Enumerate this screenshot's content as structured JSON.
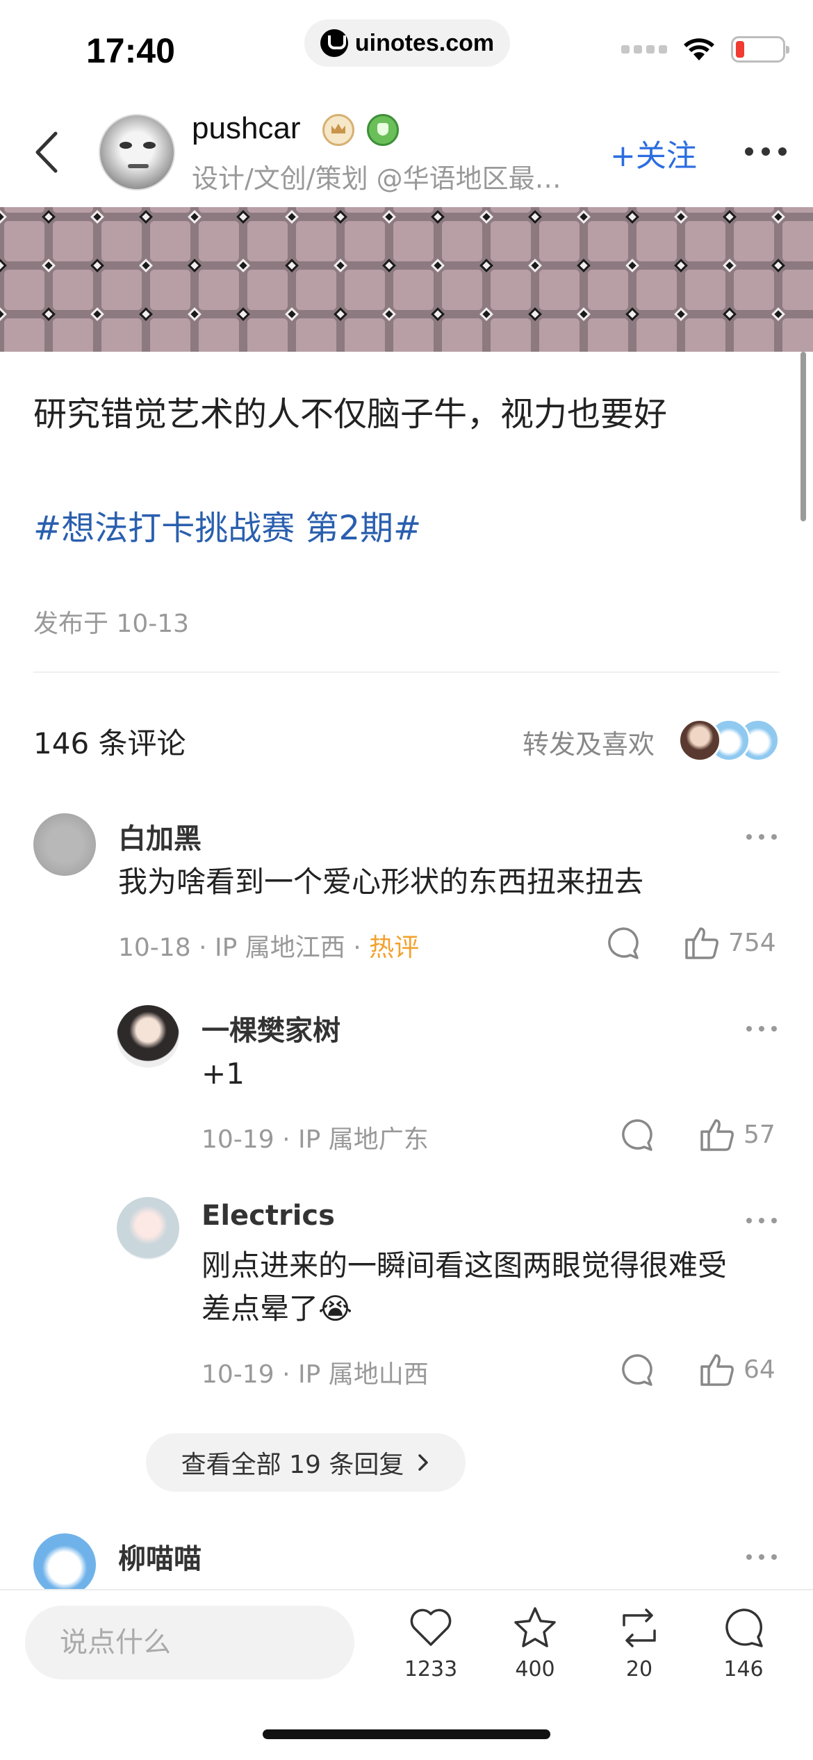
{
  "status_bar": {
    "time": "17:40",
    "url": "uinotes.com"
  },
  "header": {
    "user_name": "pushcar",
    "user_desc": "设计/文创/策划 @华语地区最…",
    "follow_label": "+关注",
    "back_icon": "chevron-left-icon",
    "more_icon": "more-horizontal-icon"
  },
  "post": {
    "text": "研究错觉艺术的人不仅脑子牛，视力也要好",
    "tag": "#想法打卡挑战赛 第2期#",
    "date": "发布于 10-13"
  },
  "comments_header": {
    "title": "146 条评论",
    "reposts_label": "转发及喜欢"
  },
  "comments": [
    {
      "name": "白加黑",
      "text": "我为啥看到一个爱心形状的东西扭来扭去",
      "date": "10-18",
      "location": "IP 属地江西",
      "hot": "热评",
      "likes": "754"
    },
    {
      "name": "一棵樊家树",
      "text": "+1",
      "date": "10-19",
      "location": "IP 属地广东",
      "likes": "57"
    },
    {
      "name": "Electrics",
      "text_line1": "刚点进来的一瞬间看这图两眼觉得很难受",
      "text_line2": "差点晕了😭",
      "date": "10-19",
      "location": "IP 属地山西",
      "likes": "64"
    },
    {
      "name": "柳喵喵"
    }
  ],
  "view_replies_label": "查看全部 19 条回复",
  "separator": "·",
  "bottom_bar": {
    "input_placeholder": "说点什么",
    "likes": "1233",
    "favorites": "400",
    "reposts": "20",
    "comments": "146"
  },
  "colors": {
    "accent_blue": "#2b6de0",
    "tag_blue": "#2a5fae",
    "hot_orange": "#f3a12c"
  }
}
